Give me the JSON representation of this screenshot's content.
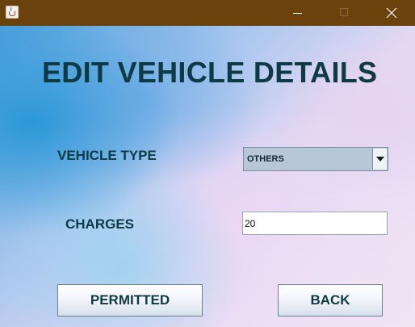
{
  "window": {
    "app_icon": "java-cup-icon",
    "controls": {
      "minimize_icon": "minimize-icon",
      "maximize_icon": "maximize-icon",
      "close_icon": "close-icon"
    },
    "titlebar_color": "#6b420c"
  },
  "form": {
    "heading": "EDIT VEHICLE DETAILS",
    "vehicle_type": {
      "label": "VEHICLE TYPE",
      "selected": "OTHERS",
      "dropdown_icon": "chevron-down-icon"
    },
    "charges": {
      "label": "CHARGES",
      "value": "20"
    },
    "buttons": {
      "permitted": "PERMITTED",
      "back": "BACK"
    }
  },
  "colors": {
    "text_primary": "#0d3a45",
    "combo_background": "#b7c7d8"
  }
}
